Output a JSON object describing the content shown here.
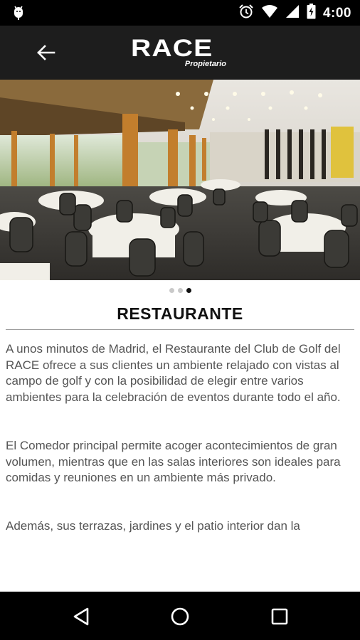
{
  "status_bar": {
    "time": "4:00",
    "icons": [
      "android-debug-icon",
      "alarm-icon",
      "wifi-icon",
      "signal-icon",
      "battery-icon"
    ]
  },
  "app_bar": {
    "logo_main": "RACE",
    "logo_sub": "Propietario",
    "back_icon": "arrow-back-icon"
  },
  "hero": {
    "description_icon": "restaurant-photo",
    "pages": 3,
    "active_page": 3
  },
  "section": {
    "title": "RESTAURANTE"
  },
  "paragraphs": [
    "A unos minutos de Madrid, el Restaurante del Club de Golf del RACE ofrece a sus clientes un ambiente relajado con vistas al campo de golf y con la posibilidad de elegir entre varios ambientes para la celebración de eventos durante todo el año.",
    "El Comedor principal permite acoger acontecimientos de gran volumen, mientras que en las salas interiores son ideales para comidas y reuniones en un ambiente más privado.",
    "Además, sus terrazas, jardines y el patio interior dan la"
  ],
  "nav_bar": {
    "icons": [
      "back-triangle-icon",
      "home-circle-icon",
      "recents-square-icon"
    ]
  },
  "colors": {
    "status_bar": "#000000",
    "app_bar": "#1d1d1d",
    "text": "#555555",
    "title": "#111111"
  }
}
